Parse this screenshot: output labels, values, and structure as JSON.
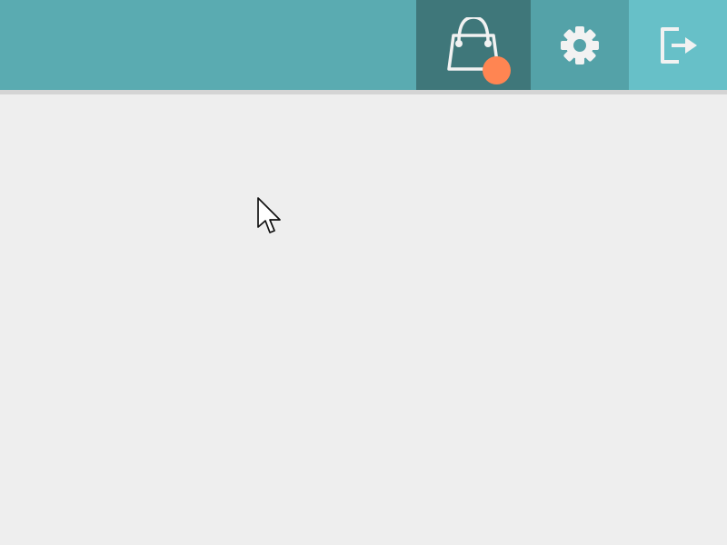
{
  "header": {
    "colors": {
      "bar": "#5aabb1",
      "divider": "#d4d4d4",
      "shop_button_active": "#3f777a",
      "settings_button": "#54a2a8",
      "logout_button": "#67c0c8",
      "icon": "#f2f2f2",
      "badge": "#ff8552"
    },
    "buttons": [
      {
        "name": "shopping-bag-button",
        "icon": "shopping-bag-icon",
        "state": "active",
        "badge": {
          "visible": true,
          "text": ""
        }
      },
      {
        "name": "settings-button",
        "icon": "gear-icon",
        "state": "normal"
      },
      {
        "name": "logout-button",
        "icon": "logout-icon",
        "state": "normal"
      }
    ]
  },
  "main": {
    "background": "#eeeeee"
  },
  "cursor": {
    "icon": "mouse-pointer-icon",
    "visible": true
  }
}
